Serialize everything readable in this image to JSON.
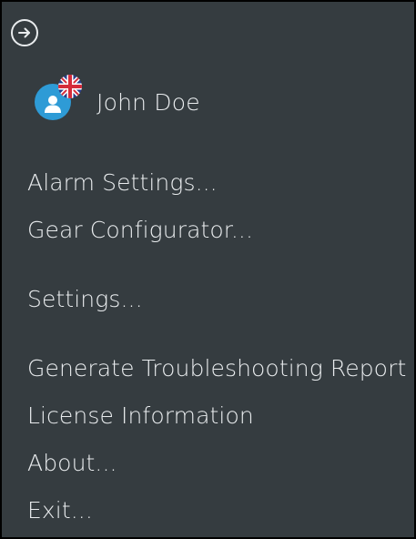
{
  "panel": {
    "collapse_icon": "arrow-right-circle-icon",
    "colors": {
      "background": "#353c40",
      "text": "#e9ecee",
      "avatar": "#2e9bd6",
      "border": "#000000"
    }
  },
  "user": {
    "name": "John Doe",
    "avatar_icon": "user-avatar-icon",
    "badge_icon": "uk-flag-icon"
  },
  "menu": {
    "items": [
      {
        "label": "Alarm Settings..."
      },
      {
        "label": "Gear Configurator..."
      },
      {
        "label": "Settings..."
      },
      {
        "label": "Generate Troubleshooting Report"
      },
      {
        "label": "License Information"
      },
      {
        "label": "About..."
      },
      {
        "label": "Exit..."
      }
    ]
  }
}
